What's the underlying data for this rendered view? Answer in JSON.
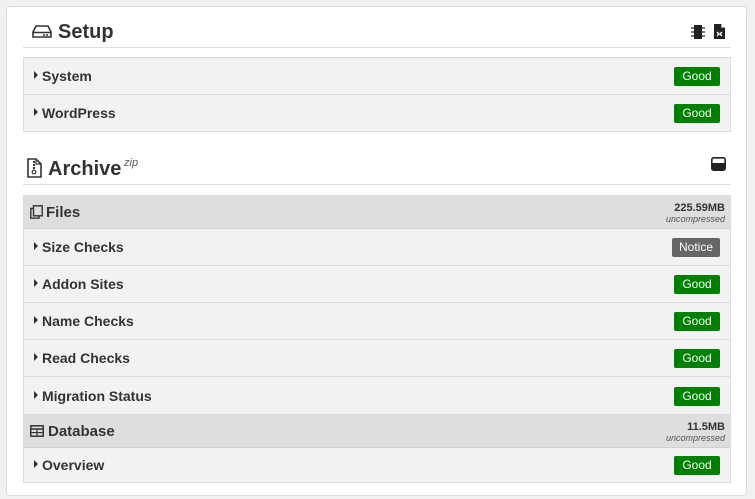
{
  "setup": {
    "title": "Setup",
    "rows": [
      {
        "label": "System",
        "status": "Good"
      },
      {
        "label": "WordPress",
        "status": "Good"
      }
    ]
  },
  "archive": {
    "title": "Archive",
    "format": "zip",
    "files": {
      "title": "Files",
      "size": "225.59MB",
      "size_note": "uncompressed",
      "rows": [
        {
          "label": "Size Checks",
          "status": "Notice"
        },
        {
          "label": "Addon Sites",
          "status": "Good"
        },
        {
          "label": "Name Checks",
          "status": "Good"
        },
        {
          "label": "Read Checks",
          "status": "Good"
        },
        {
          "label": "Migration Status",
          "status": "Good"
        }
      ]
    },
    "database": {
      "title": "Database",
      "size": "11.5MB",
      "size_note": "uncompressed",
      "rows": [
        {
          "label": "Overview",
          "status": "Good"
        }
      ]
    }
  },
  "colors": {
    "good": "#008000",
    "notice": "#666666"
  }
}
